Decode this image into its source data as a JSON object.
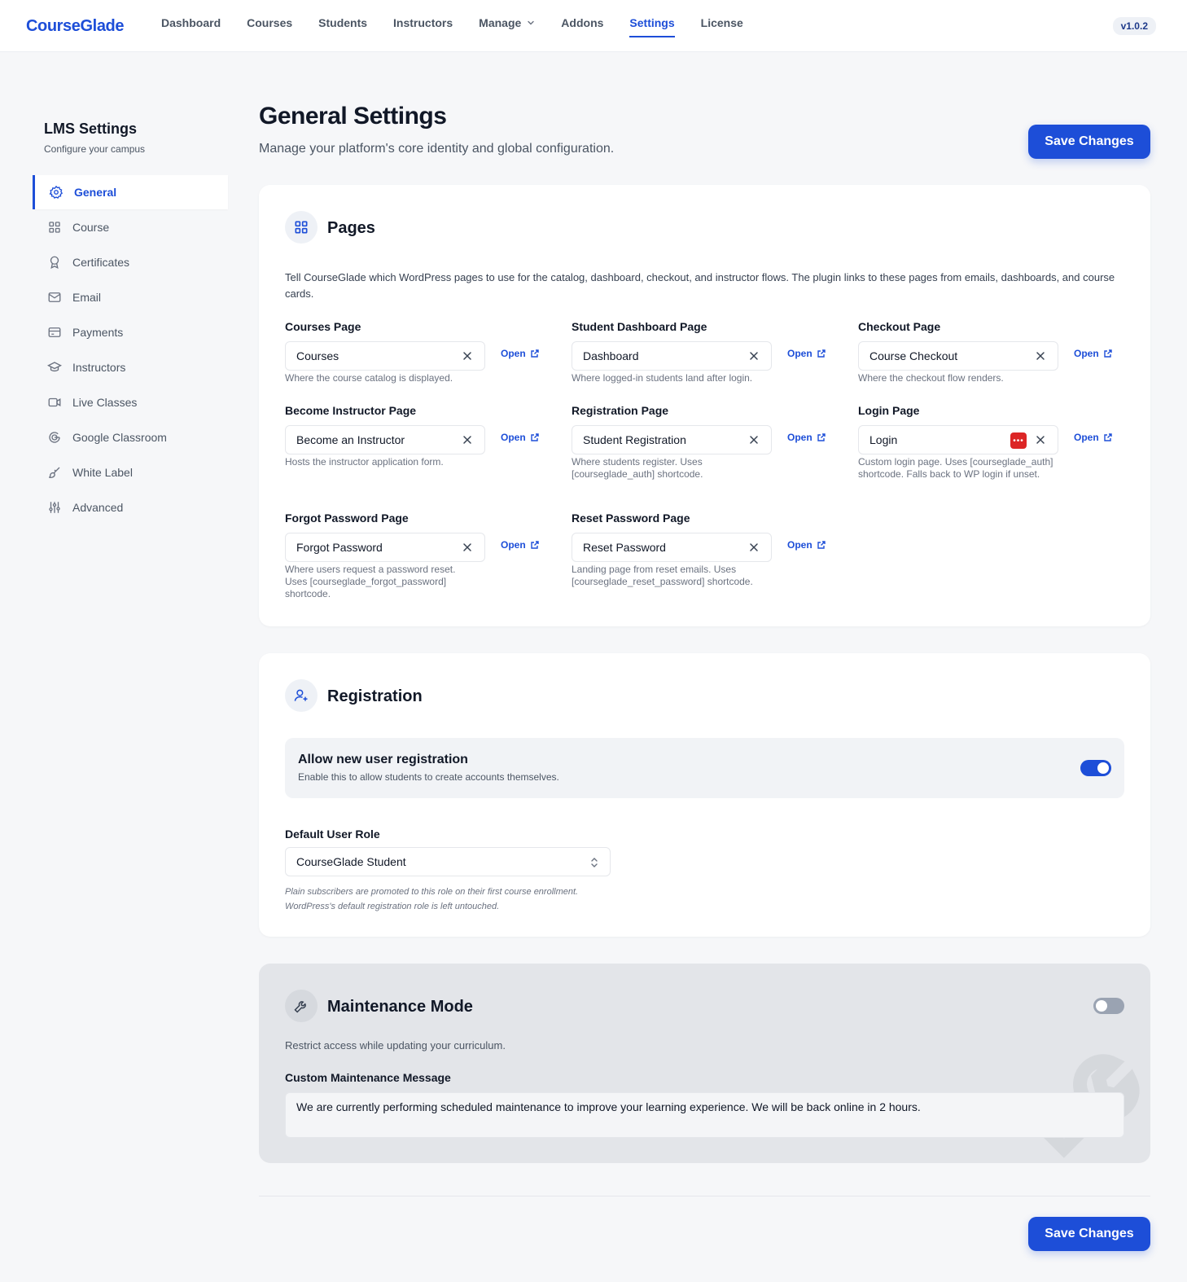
{
  "brand": "CourseGlade",
  "nav": {
    "items": [
      {
        "label": "Dashboard"
      },
      {
        "label": "Courses"
      },
      {
        "label": "Students"
      },
      {
        "label": "Instructors"
      },
      {
        "label": "Manage"
      },
      {
        "label": "Addons"
      },
      {
        "label": "Settings"
      },
      {
        "label": "License"
      }
    ],
    "active": "Settings",
    "version": "v1.0.2"
  },
  "sidebar": {
    "title": "LMS Settings",
    "subtitle": "Configure your campus",
    "items": [
      {
        "label": "General",
        "icon": "gear-icon"
      },
      {
        "label": "Course",
        "icon": "grid-icon"
      },
      {
        "label": "Certificates",
        "icon": "award-icon"
      },
      {
        "label": "Email",
        "icon": "mail-icon"
      },
      {
        "label": "Payments",
        "icon": "credit-card-icon"
      },
      {
        "label": "Instructors",
        "icon": "graduation-cap-icon"
      },
      {
        "label": "Live Classes",
        "icon": "video-icon"
      },
      {
        "label": "Google Classroom",
        "icon": "google-icon"
      },
      {
        "label": "White Label",
        "icon": "brush-icon"
      },
      {
        "label": "Advanced",
        "icon": "sliders-icon"
      }
    ],
    "active": "General"
  },
  "header": {
    "title": "General Settings",
    "subtitle": "Manage your platform's core identity and global configuration.",
    "save_label": "Save Changes"
  },
  "pages": {
    "title": "Pages",
    "description": "Tell CourseGlade which WordPress pages to use for the catalog, dashboard, checkout, and instructor flows. The plugin links to these pages from emails, dashboards, and course cards.",
    "open_label": "Open",
    "fields": [
      {
        "label": "Courses Page",
        "value": "Courses",
        "help": "Where the course catalog is displayed."
      },
      {
        "label": "Student Dashboard Page",
        "value": "Dashboard",
        "help": "Where logged-in students land after login."
      },
      {
        "label": "Checkout Page",
        "value": "Course Checkout",
        "help": "Where the checkout flow renders."
      },
      {
        "label": "Become Instructor Page",
        "value": "Become an Instructor",
        "help": "Hosts the instructor application form."
      },
      {
        "label": "Registration Page",
        "value": "Student Registration",
        "help": "Where students register. Uses [courseglade_auth] shortcode."
      },
      {
        "label": "Login Page",
        "value": "Login",
        "help": "Custom login page. Uses [courseglade_auth] shortcode. Falls back to WP login if unset."
      },
      {
        "label": "Forgot Password Page",
        "value": "Forgot Password",
        "help": "Where users request a password reset. Uses [courseglade_forgot_password] shortcode."
      },
      {
        "label": "Reset Password Page",
        "value": "Reset Password",
        "help": "Landing page from reset emails. Uses [courseglade_reset_password] shortcode."
      }
    ]
  },
  "registration": {
    "title": "Registration",
    "allow_title": "Allow new user registration",
    "allow_desc": "Enable this to allow students to create accounts themselves.",
    "allow_enabled": true,
    "role_label": "Default User Role",
    "role_value": "CourseGlade Student",
    "role_help": "Plain subscribers are promoted to this role on their first course enrollment. WordPress's default registration role is left untouched."
  },
  "maintenance": {
    "title": "Maintenance Mode",
    "enabled": false,
    "description": "Restrict access while updating your curriculum.",
    "message_label": "Custom Maintenance Message",
    "message": "We are currently performing scheduled maintenance to improve your learning experience. We will be back online in 2 hours."
  },
  "colors": {
    "accent": "#1d4ed8",
    "toggle_off": "#9aa3b2"
  }
}
